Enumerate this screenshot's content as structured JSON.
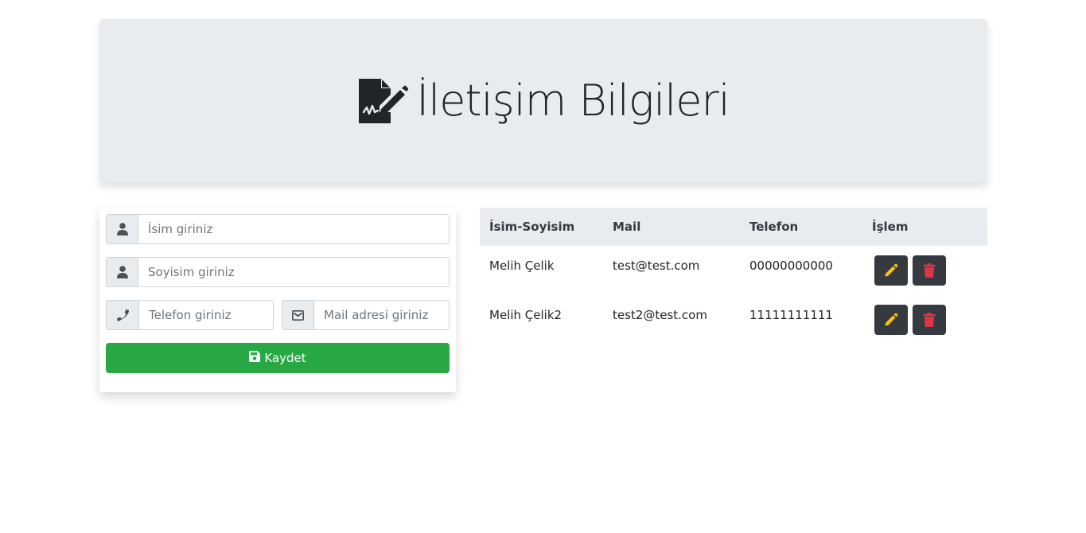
{
  "header": {
    "title": "İletişim Bilgileri",
    "icon": "file-signature-icon"
  },
  "form": {
    "first_name_placeholder": "İsim giriniz",
    "last_name_placeholder": "Soyisim giriniz",
    "phone_placeholder": "Telefon giriniz",
    "mail_placeholder": "Mail adresi giriniz",
    "save_label": "Kaydet",
    "save_color": "#28a745"
  },
  "table": {
    "columns": [
      "İsim-Soyisim",
      "Mail",
      "Telefon",
      "İşlem"
    ],
    "rows": [
      {
        "name": "Melih Çelik",
        "mail": "test@test.com",
        "phone": "00000000000"
      },
      {
        "name": "Melih Çelik2",
        "mail": "test2@test.com",
        "phone": "11111111111"
      }
    ],
    "edit_icon_color": "#ffc107",
    "delete_icon_color": "#dc3545"
  }
}
